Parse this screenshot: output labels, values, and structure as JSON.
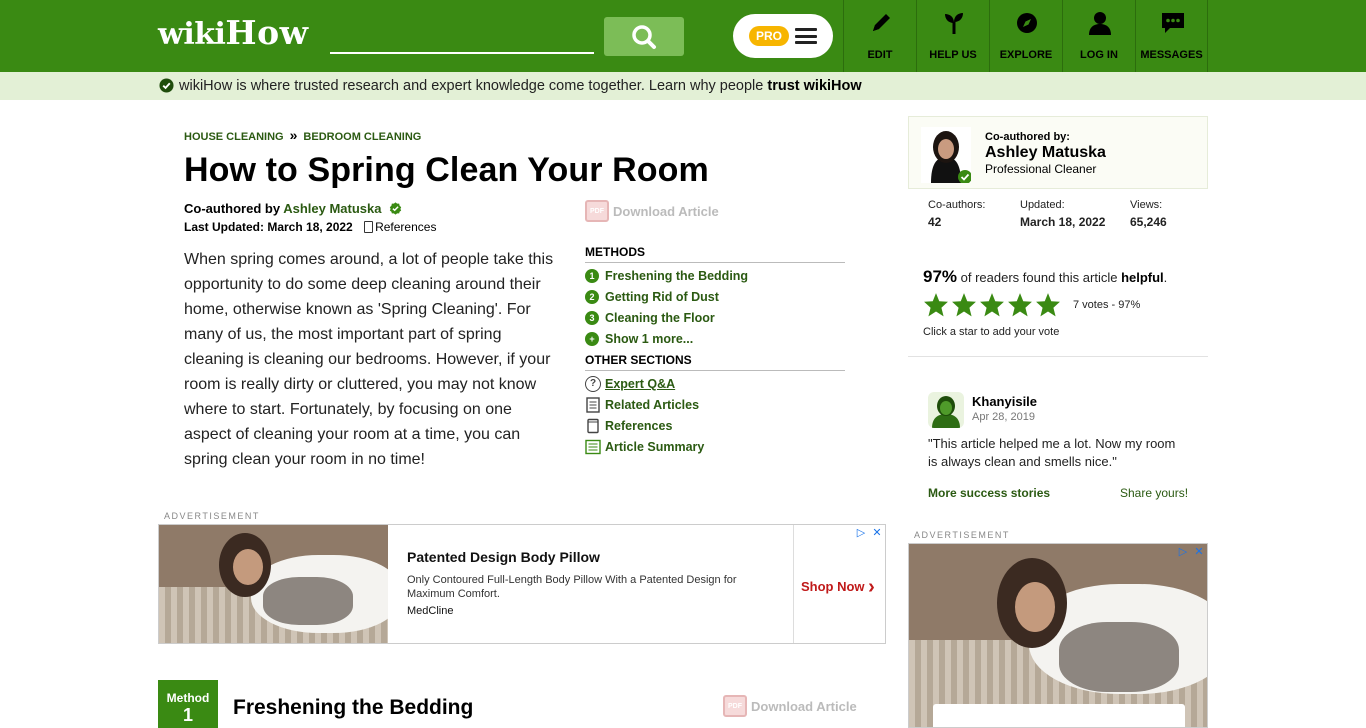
{
  "header": {
    "logo": {
      "part1": "wiki",
      "part2": "How"
    },
    "search": {
      "placeholder": "",
      "value": ""
    },
    "pro_badge": "PRO",
    "nav": [
      {
        "label": "EDIT",
        "icon": "pencil-icon"
      },
      {
        "label": "HELP US",
        "icon": "sprout-icon"
      },
      {
        "label": "EXPLORE",
        "icon": "compass-icon"
      },
      {
        "label": "LOG IN",
        "icon": "user-icon"
      },
      {
        "label": "MESSAGES",
        "icon": "chat-icon"
      }
    ],
    "colors": {
      "brand": "#3a8a13",
      "search_button": "#7cbd57",
      "pro": "#f7b500"
    }
  },
  "trust_banner": {
    "text": "wikiHow is where trusted research and expert knowledge come together. Learn why people ",
    "link": "trust wikiHow",
    "background": "#e3f0d6"
  },
  "article": {
    "breadcrumbs": [
      "HOUSE CLEANING",
      "BEDROOM CLEANING"
    ],
    "breadcrumb_sep": "»",
    "title": "How to Spring Clean Your Room",
    "coauthored_prefix": "Co-authored by",
    "coauthor": "Ashley Matuska",
    "last_updated": "Last Updated: March 18, 2022",
    "references_link": "References",
    "intro": "When spring comes around, a lot of people take this opportunity to do some deep cleaning around their home, otherwise known as 'Spring Cleaning'. For many of us, the most important part of spring cleaning is cleaning our bedrooms. However, if your room is really dirty or cluttered, you may not know where to start. Fortunately, by focusing on one aspect of cleaning your room at a time, you can spring clean your room in no time!"
  },
  "toc": {
    "download_label": "Download Article",
    "pdf_icon_text": "PDF",
    "methods_heading": "METHODS",
    "methods": [
      {
        "num": "1",
        "label": "Freshening the Bedding"
      },
      {
        "num": "2",
        "label": "Getting Rid of Dust"
      },
      {
        "num": "3",
        "label": "Cleaning the Floor"
      },
      {
        "num": "+",
        "label": "Show 1 more..."
      }
    ],
    "other_heading": "OTHER SECTIONS",
    "other": [
      {
        "label": "Expert Q&A",
        "icon": "question-icon"
      },
      {
        "label": "Related Articles",
        "icon": "document-icon"
      },
      {
        "label": "References",
        "icon": "page-icon"
      },
      {
        "label": "Article Summary",
        "icon": "list-icon"
      }
    ]
  },
  "ad_main": {
    "label": "ADVERTISEMENT",
    "title": "Patented Design Body Pillow",
    "description": "Only Contoured Full-Length Body Pillow With a Patented Design for Maximum Comfort.",
    "brand": "MedCline",
    "cta": "Shop Now",
    "cta_arrow": "›"
  },
  "method_section": {
    "badge_label": "Method",
    "badge_number": "1",
    "title": "Freshening the Bedding",
    "download_label": "Download Article"
  },
  "sidebar": {
    "author_card": {
      "coauthored_by": "Co-authored by:",
      "name": "Ashley Matuska",
      "role": "Professional Cleaner"
    },
    "stats": [
      {
        "label": "Co-authors:",
        "value": "42"
      },
      {
        "label": "Updated:",
        "value": "March 18, 2022"
      },
      {
        "label": "Views:",
        "value": "65,246"
      }
    ],
    "helpful": {
      "percent": "97%",
      "text_mid": " of readers found this article ",
      "word": "helpful",
      "end": ".",
      "stars_filled": 5,
      "votes": "7 votes - 97%",
      "click_hint": "Click a star to add your vote"
    },
    "review": {
      "name": "Khanyisile",
      "date": "Apr 28, 2019",
      "text": "\"This article helped me a lot. Now my room is always clean and smells nice.\"",
      "more_link": "More success stories",
      "share_link": "Share yours!"
    },
    "ad_label": "ADVERTISEMENT"
  }
}
